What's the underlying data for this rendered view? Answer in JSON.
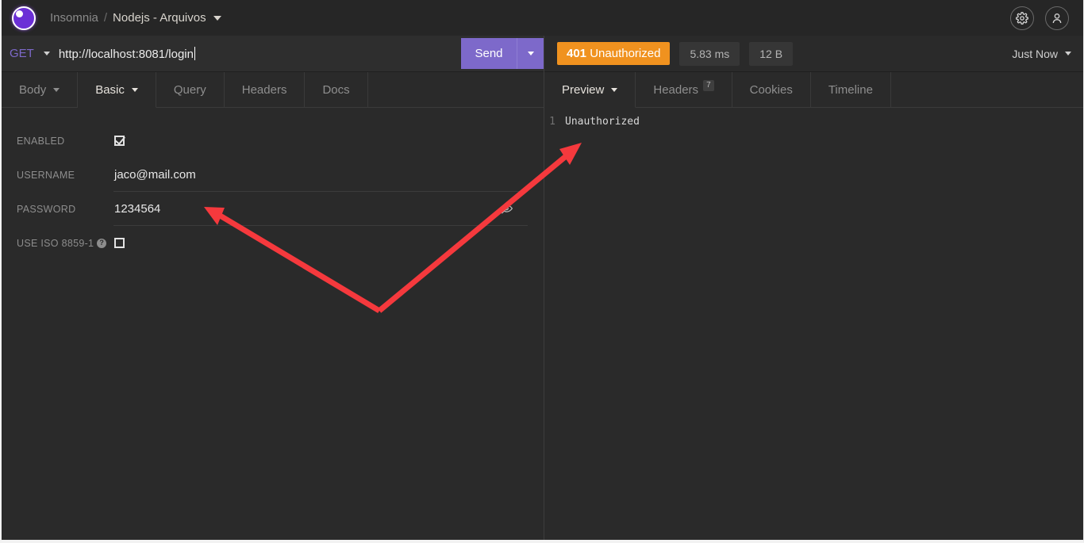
{
  "titlebar": {
    "logo_name": "insomnia-logo",
    "app_name": "Insomnia",
    "separator": "/",
    "workspace": "Nodejs - Arquivos",
    "settings_icon": "gear-icon",
    "account_icon": "user-icon"
  },
  "request": {
    "method": "GET",
    "url": "http://localhost:8081/login",
    "send_label": "Send"
  },
  "response_status": {
    "code": "401",
    "text": "Unauthorized",
    "status_color": "#f0921f",
    "time": "5.83 ms",
    "size": "12 B",
    "history_label": "Just Now"
  },
  "request_tabs": [
    {
      "label": "Body",
      "has_caret": true,
      "active": false
    },
    {
      "label": "Basic",
      "has_caret": true,
      "active": true
    },
    {
      "label": "Query",
      "has_caret": false,
      "active": false
    },
    {
      "label": "Headers",
      "has_caret": false,
      "active": false
    },
    {
      "label": "Docs",
      "has_caret": false,
      "active": false
    }
  ],
  "response_tabs": [
    {
      "label": "Preview",
      "has_caret": true,
      "active": true,
      "badge": ""
    },
    {
      "label": "Headers",
      "has_caret": false,
      "active": false,
      "badge": "7"
    },
    {
      "label": "Cookies",
      "has_caret": false,
      "active": false,
      "badge": ""
    },
    {
      "label": "Timeline",
      "has_caret": false,
      "active": false,
      "badge": ""
    }
  ],
  "auth_form": {
    "enabled": {
      "label": "ENABLED",
      "checked": true
    },
    "username": {
      "label": "USERNAME",
      "value": "jaco@mail.com"
    },
    "password": {
      "label": "PASSWORD",
      "value": "1234564",
      "toggle_icon": "eye-slash-icon"
    },
    "iso": {
      "label": "USE ISO 8859-1",
      "checked": false,
      "help_icon": "question-mark-icon",
      "help_glyph": "?"
    }
  },
  "response_body": {
    "lines": [
      {
        "number": "1",
        "text": "Unauthorized"
      }
    ]
  },
  "annotation": {
    "color": "#f5393d",
    "shape": "double-headed-v-arrow"
  }
}
